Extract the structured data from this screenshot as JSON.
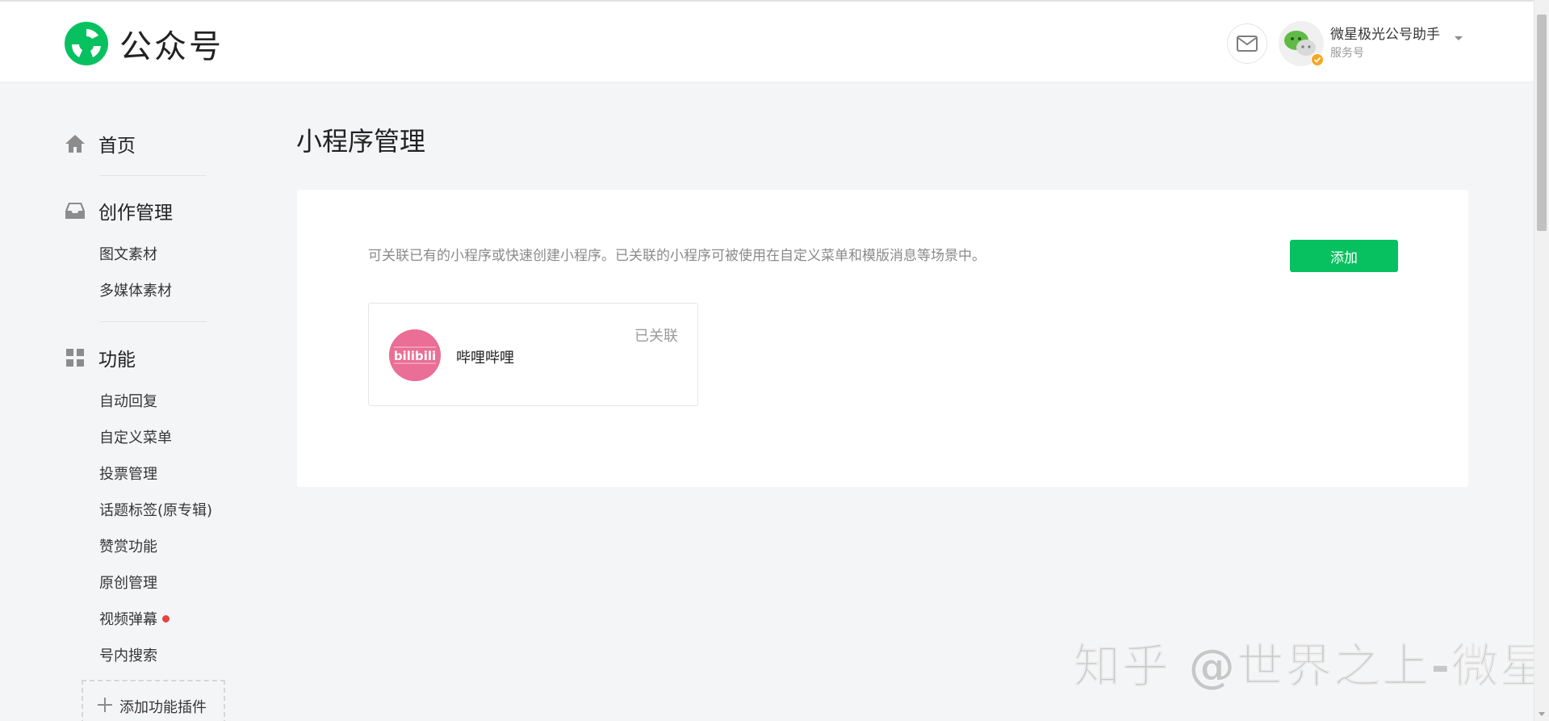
{
  "header": {
    "logo_text": "公众号",
    "account_name": "微星极光公号助手",
    "account_type": "服务号"
  },
  "sidebar": {
    "groups": [
      {
        "label": "首页",
        "icon": "home-icon"
      },
      {
        "label": "创作管理",
        "icon": "inbox-icon"
      },
      {
        "label": "功能",
        "icon": "grid-icon"
      }
    ],
    "creation_items": [
      "图文素材",
      "多媒体素材"
    ],
    "feature_items": [
      "自动回复",
      "自定义菜单",
      "投票管理",
      "话题标签(原专辑)",
      "赞赏功能",
      "原创管理",
      "视频弹幕",
      "号内搜索"
    ],
    "add_plugin_label": "添加功能插件"
  },
  "main": {
    "page_title": "小程序管理",
    "description": "可关联已有的小程序或快速创建小程序。已关联的小程序可被使用在自定义菜单和模版消息等场景中。",
    "add_button_label": "添加",
    "mini_programs": [
      {
        "name": "哔哩哔哩",
        "status": "已关联",
        "avatar_text": "bilibili"
      }
    ]
  },
  "watermark": "知乎 @世界之上-微星",
  "colors": {
    "brand_green": "#07c160",
    "badge_red": "#e64340",
    "bilibili_pink": "#ea6e96"
  }
}
